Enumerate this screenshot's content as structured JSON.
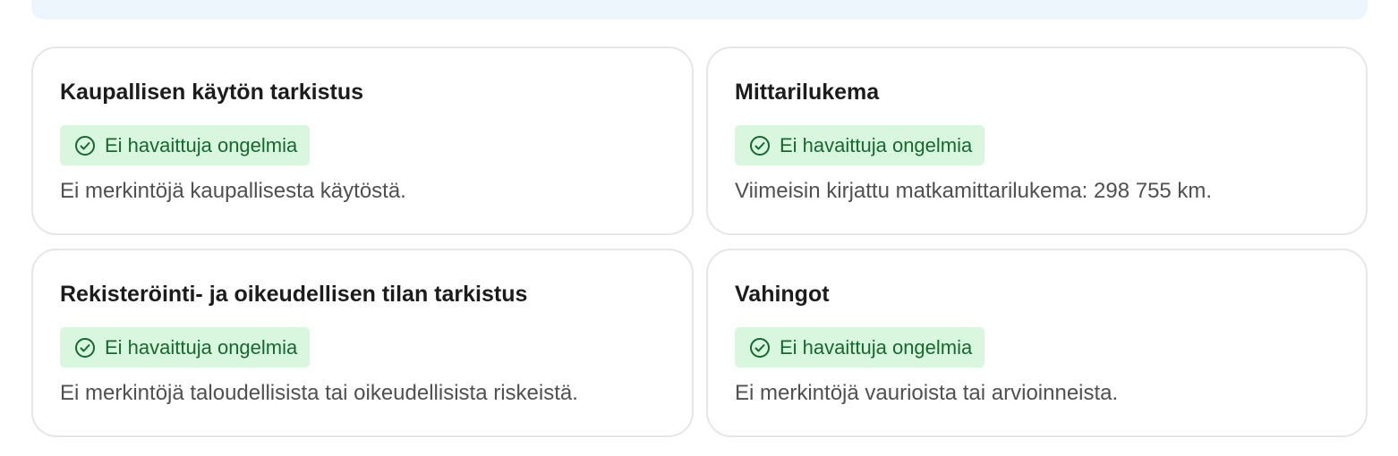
{
  "cards": [
    {
      "title": "Kaupallisen käytön tarkistus",
      "status": "Ei havaittuja ongelmia",
      "description": "Ei merkintöjä kaupallisesta käytöstä."
    },
    {
      "title": "Mittarilukema",
      "status": "Ei havaittuja ongelmia",
      "description": "Viimeisin kirjattu matkamittarilukema: 298 755 km."
    },
    {
      "title": "Rekisteröinti- ja oikeudellisen tilan tarkistus",
      "status": "Ei havaittuja ongelmia",
      "description": "Ei merkintöjä taloudellisista tai oikeudellisista riskeistä."
    },
    {
      "title": "Vahingot",
      "status": "Ei havaittuja ongelmia",
      "description": "Ei merkintöjä vaurioista tai arvioinneista."
    }
  ],
  "colors": {
    "badge_background": "#d9f7de",
    "badge_text": "#14692f",
    "banner_background": "#eef6fd",
    "card_border": "#e6e6e6"
  },
  "icons": {
    "status": "check-circle-icon"
  }
}
